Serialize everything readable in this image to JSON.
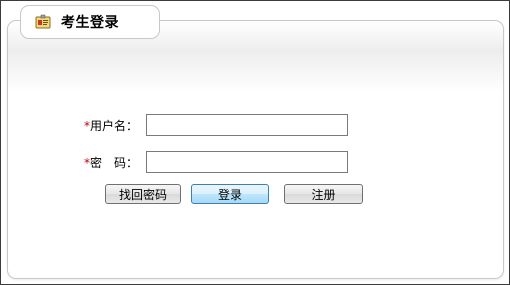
{
  "tab": {
    "title": "考生登录",
    "icon": "id-card-icon"
  },
  "form": {
    "required_mark": "*",
    "username_label": "用户名：",
    "password_label": "密　码：",
    "username_value": "",
    "password_value": ""
  },
  "buttons": {
    "forgot_label": "找回密码",
    "login_label": "登录",
    "register_label": "注册"
  },
  "colors": {
    "required": "#cc0000",
    "border": "#c8c8c8",
    "login_button_border": "#3c7fb1"
  }
}
